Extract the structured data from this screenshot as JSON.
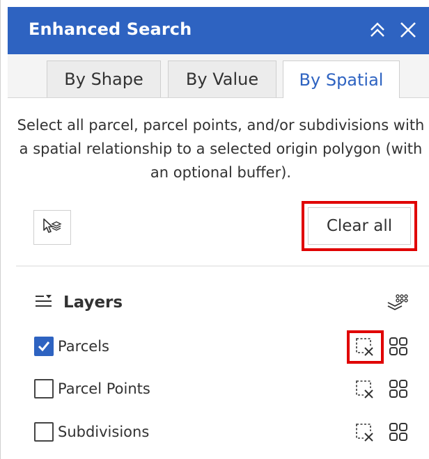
{
  "window": {
    "title": "Enhanced Search",
    "collapse_icon": "double-chevron-up-icon",
    "close_icon": "close-icon"
  },
  "tabs": [
    {
      "label": "By Shape",
      "active": false
    },
    {
      "label": "By Value",
      "active": false
    },
    {
      "label": "By Spatial",
      "active": true
    }
  ],
  "description": {
    "line1": "Select all parcel, parcel points, and/or subdivisions with",
    "line2": "a spatial relationship to a selected origin polygon (with",
    "line3": "an optional buffer)."
  },
  "toolbar": {
    "select_tool_icon": "select-features-icon",
    "clear_all_label": "Clear all"
  },
  "layers": {
    "heading": "Layers",
    "list_icon": "list-collapse-icon",
    "options_icon": "layer-options-icon",
    "items": [
      {
        "label": "Parcels",
        "checked": true,
        "clear_icon": "clear-selection-icon",
        "table_icon": "grid-icon"
      },
      {
        "label": "Parcel Points",
        "checked": false,
        "clear_icon": "clear-selection-icon",
        "table_icon": "grid-icon"
      },
      {
        "label": "Subdivisions",
        "checked": false,
        "clear_icon": "clear-selection-icon",
        "table_icon": "grid-icon"
      }
    ]
  },
  "colors": {
    "header_bg": "#2e63c1",
    "active_tab_text": "#2e63c1",
    "highlight_border": "#e00000",
    "checkbox_checked": "#2e63c1"
  }
}
